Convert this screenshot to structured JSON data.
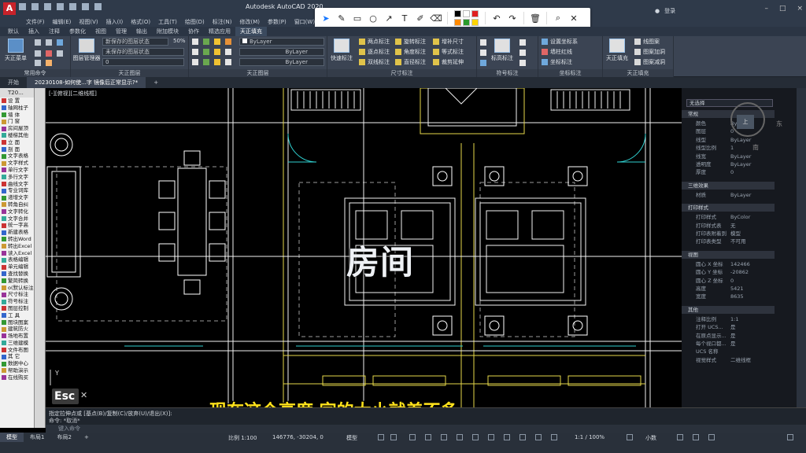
{
  "app": {
    "title": "Autodesk AutoCAD 2020",
    "icon_letter": "A",
    "user": "登录",
    "window_controls": [
      "–",
      "□",
      "×"
    ]
  },
  "menu": [
    "文件(F)",
    "编辑(E)",
    "视图(V)",
    "插入(I)",
    "格式(O)",
    "工具(T)",
    "绘图(D)",
    "标注(N)",
    "修改(M)",
    "参数(P)",
    "窗口(W)"
  ],
  "annotation_toolbar": {
    "tools": [
      "select-icon",
      "pen-icon",
      "rectangle-icon",
      "circle-icon",
      "arrow-icon",
      "text-icon",
      "marker-icon",
      "eraser-icon"
    ],
    "colors": [
      "#000000",
      "#ffffff",
      "#e02020",
      "#ff8a00",
      "#2b9b2b",
      "#ffd400"
    ],
    "actions": [
      "undo-icon",
      "redo-icon",
      "delete-icon",
      "zoom-icon",
      "close-icon"
    ]
  },
  "ribbon_tabs": [
    "默认",
    "插入",
    "注释",
    "参数化",
    "视图",
    "管理",
    "输出",
    "附加模块",
    "协作",
    "精选应用",
    "天正填充"
  ],
  "ribbon": {
    "panel_common": {
      "title": "常用命令",
      "big_button": "天正菜单"
    },
    "panel_layer": {
      "title": "天正图层",
      "big_button": "图层管理器",
      "layer_combo": "新保存的图层状态",
      "layer_value": "0",
      "scale_value": "50%",
      "unsaved": "未保存的图层状态"
    },
    "panel_props": {
      "color": "ByLayer",
      "linetype": "ByLayer",
      "lineweight": "ByLayer"
    },
    "panel_dim": {
      "title": "尺寸标注",
      "big_button": "快速标注",
      "items": [
        "两点标注",
        "旋转标注",
        "增补尺寸",
        "逐点标注",
        "角度标注",
        "等式标注",
        "双线标注",
        "直径标注",
        "裁剪延伸"
      ]
    },
    "panel_symbol": {
      "title": "符号标注",
      "big_button": "标高标注"
    },
    "panel_coord": {
      "title": "坐标标注",
      "items": [
        "设置坐标系",
        "墙柱红线",
        "坐标标注"
      ]
    },
    "panel_fill": {
      "title": "天正填充",
      "big_button": "天正填充",
      "items": [
        "线图案",
        "图案加洞",
        "图案减洞"
      ]
    }
  },
  "file_tabs": [
    "开始",
    "20230108-如何使...字 镜像后正常显示?*"
  ],
  "tool_palette": {
    "header": "T20...",
    "items": [
      "设 置",
      "轴网柱子",
      "墙 体",
      "门 窗",
      "房间屋顶",
      "楼梯其他",
      "立 面",
      "剖 面",
      "文字表格",
      "文字样式",
      "单行文字",
      "多行文字",
      "曲线文字",
      "专业词库",
      "递增文字",
      "转角自纠",
      "文字转化",
      "文字合并",
      "统一字高",
      "新建表格",
      "转出Word",
      "转出Excel",
      "读入Excel",
      "表格编辑",
      "单元编辑",
      "查找替换",
      "繁简转换",
      "o(默认标注)",
      "尺寸标注",
      "符号标注",
      "图层控制",
      "工 具",
      "图块图案",
      "建筑防火",
      "场地布置",
      "三维建模",
      "文件布图",
      "其 它",
      "数据中心",
      "帮助演示",
      "在线购买"
    ]
  },
  "canvas": {
    "viewport_label": "[-][俯视][二维线框]",
    "room_label": "房间",
    "subtitle": "现在这个高度  字的大小就差不多",
    "esc_key": "Esc",
    "ucs_y": "Y"
  },
  "properties": {
    "selection": "无选择",
    "viewcube_face": "上",
    "compass_east": "东",
    "compass_south": "南",
    "sections": [
      {
        "title": "常规",
        "rows": [
          [
            "颜色",
            "ByLayer"
          ],
          [
            "图层",
            "0"
          ],
          [
            "线型",
            "ByLayer"
          ],
          [
            "线型比例",
            "1"
          ],
          [
            "线宽",
            "ByLayer"
          ],
          [
            "透明度",
            "ByLayer"
          ],
          [
            "厚度",
            "0"
          ]
        ]
      },
      {
        "title": "三维效果",
        "rows": [
          [
            "材质",
            "ByLayer"
          ]
        ]
      },
      {
        "title": "打印样式",
        "rows": [
          [
            "打印样式",
            "ByColor"
          ],
          [
            "打印样式表",
            "无"
          ],
          [
            "打印表附着到",
            "模型"
          ],
          [
            "打印表类型",
            "不可用"
          ]
        ]
      },
      {
        "title": "视图",
        "rows": [
          [
            "圆心 X 坐标",
            "142466"
          ],
          [
            "圆心 Y 坐标",
            "-20862"
          ],
          [
            "圆心 Z 坐标",
            "0"
          ],
          [
            "高度",
            "5421"
          ],
          [
            "宽度",
            "8635"
          ]
        ]
      },
      {
        "title": "其他",
        "rows": [
          [
            "注释比例",
            "1:1"
          ],
          [
            "打开 UCS...",
            "是"
          ],
          [
            "在原点显示...",
            "是"
          ],
          [
            "每个视口都...",
            "是"
          ],
          [
            "UCS 名称",
            ""
          ],
          [
            "视觉样式",
            "二维线框"
          ]
        ]
      }
    ]
  },
  "command": {
    "line1": "指定拉伸点或 [基点(B)/复制(C)/放弃(U)/退出(X)]:",
    "line2": "命令: *取消*",
    "input_placeholder": "键入命令"
  },
  "status": {
    "layout_tabs": [
      "模型",
      "布局1",
      "布局2"
    ],
    "scale": "比例 1:100",
    "coords": "146776, -30204, 0",
    "model": "模型",
    "anno_scale": "1:1 / 100%",
    "units": "小数"
  },
  "colors": {
    "wall": "#f2f2f2",
    "furniture": "#ffffff",
    "dim_yellow": "#e6d84a",
    "dashed_gray": "#9a9a9a",
    "door_cyan": "#2fd0d0",
    "subtitle": "#ffe11b"
  }
}
